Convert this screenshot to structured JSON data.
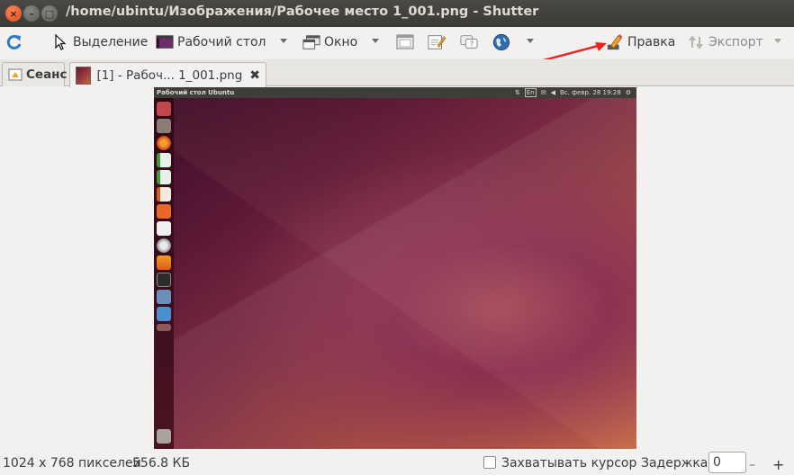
{
  "window": {
    "title": "/home/ubintu/Изображения/Рабочее место 1_001.png - Shutter",
    "close_glyph": "×",
    "min_glyph": "–",
    "max_glyph": "□"
  },
  "toolbar": {
    "selection_label": "Выделение",
    "desktop_label": "Рабочий стол",
    "window_label": "Окно",
    "edit_label": "Правка",
    "export_label": "Экспорт"
  },
  "tabs": {
    "session_label": "Сеанс",
    "image_label": "[1] - Рабоч... 1_001.png",
    "close_glyph": "✖"
  },
  "screenshot": {
    "panel_title": "Рабочий стол Ubuntu",
    "panel_lang": "En",
    "panel_datetime": "Вс. февр. 28 19:28"
  },
  "status": {
    "dimensions": "1024 x 768 пикселей",
    "filesize": "556.8 КБ",
    "capture_cursor_label": "Захватывать курсор",
    "delay_label": "Задержка:",
    "delay_value": "0"
  },
  "colors": {
    "accent_arrow": "#e8261f",
    "titlebar": "#3b3a36",
    "close_button": "#df4a16"
  }
}
